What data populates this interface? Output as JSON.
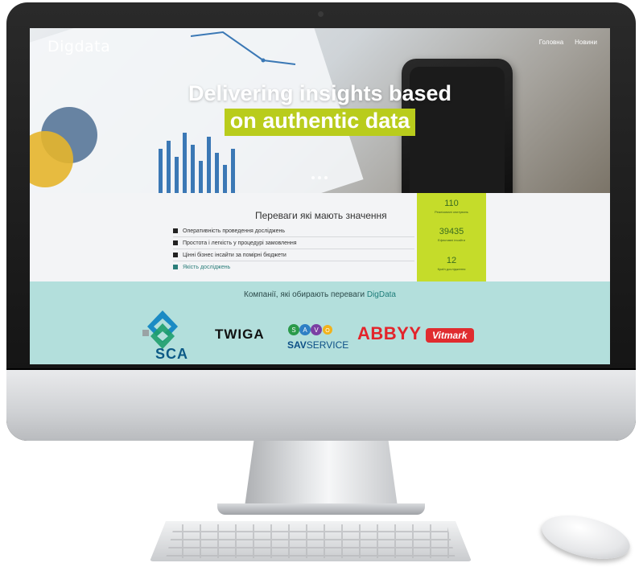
{
  "site": {
    "logo": "Digdata",
    "nav": [
      "Головна",
      "Новини"
    ]
  },
  "hero": {
    "headline_line1": "Delivering insights based",
    "headline_line2": "on authentic data",
    "slides": 3
  },
  "advantages": {
    "title": "Переваги які мають значення",
    "items": [
      "Оперативність проведення досліджень",
      "Простота і легкість у процедурі замовлення",
      "Цінні бізнес інсайти за помірні бюджети",
      "Якість досліджень"
    ],
    "stats": [
      {
        "value": "110",
        "label": "Реалізовані опитувань"
      },
      {
        "value": "39435",
        "label": "Ефективні інсайти"
      },
      {
        "value": "12",
        "label": "Країн дослідження"
      }
    ]
  },
  "clients": {
    "title": "Компанії, які обирають переваги",
    "title_accent": "DigData",
    "logos": [
      "SCA",
      "TWIGA",
      "SAV SERVICE",
      "ABBYY",
      "Vitmark"
    ],
    "sav_letters": [
      "S",
      "A",
      "V",
      "O"
    ],
    "sav_brand": "SAV",
    "sav_suffix": "SERVICE"
  },
  "colors": {
    "accent_green": "#b9cc1c",
    "stats_green": "#c5dc2a",
    "clients_bg": "#b3dfdc",
    "abbyy_red": "#e3242b"
  }
}
